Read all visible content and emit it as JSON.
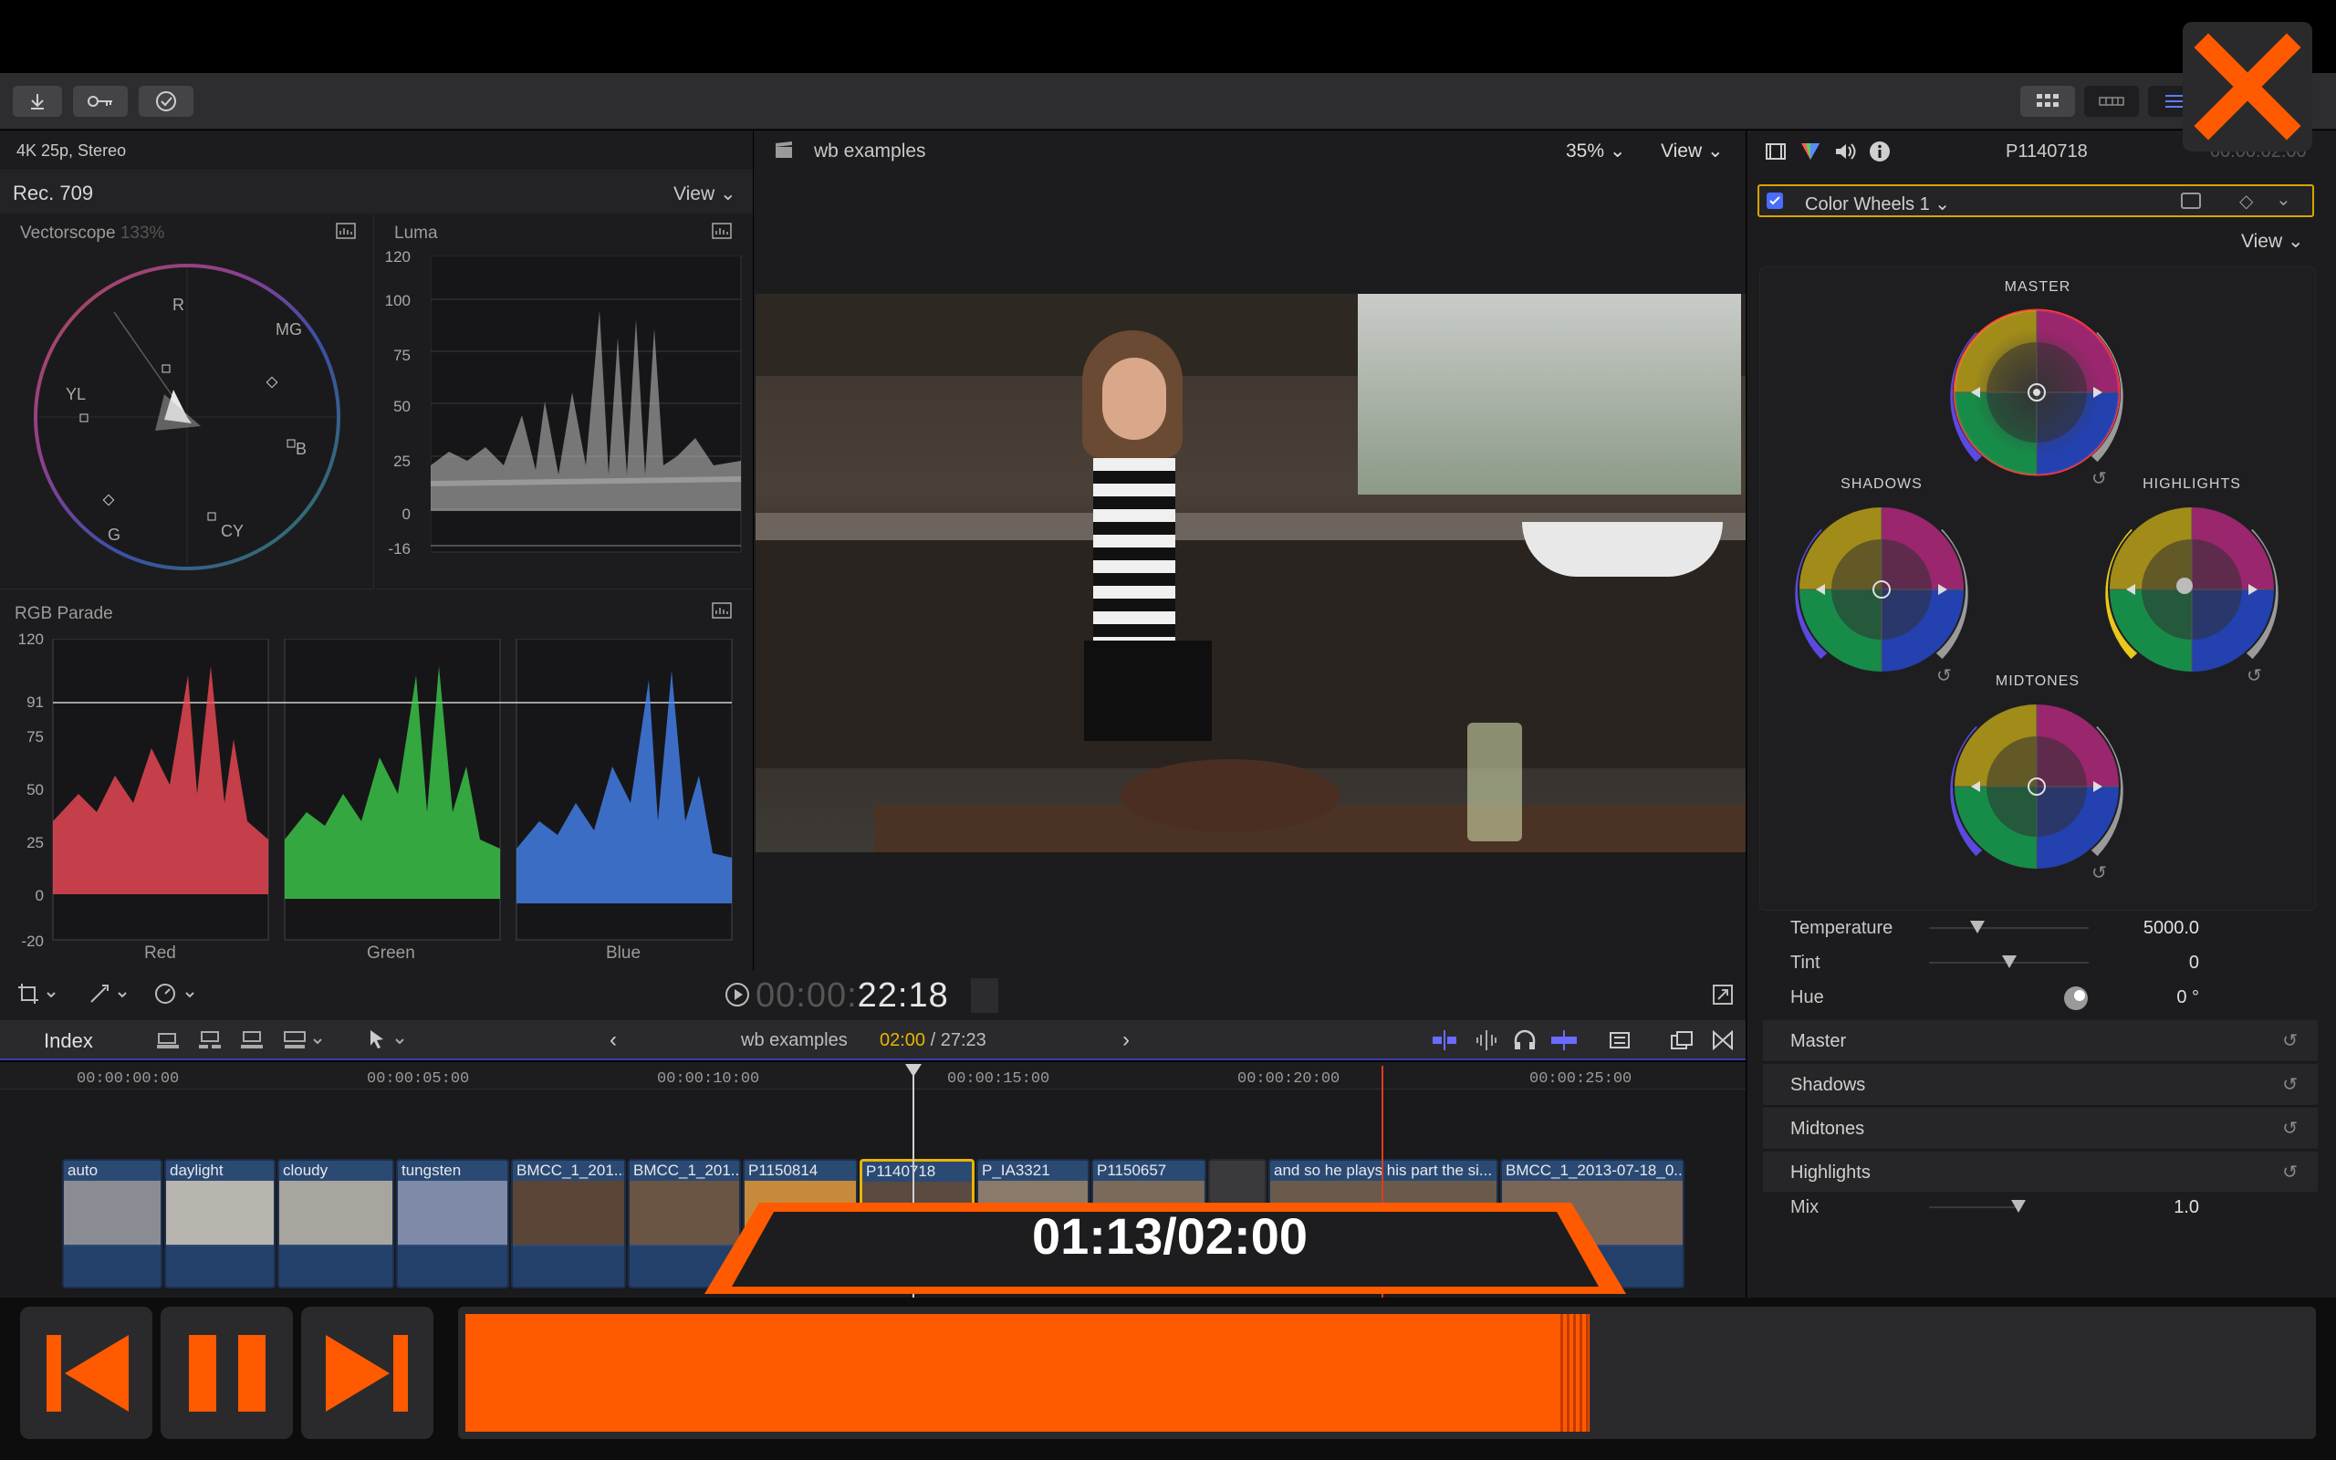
{
  "toolbar": {
    "import_icon": "download-icon",
    "keyword_icon": "key-icon",
    "check_icon": "checkmark-circle-icon"
  },
  "viewer": {
    "format": "4K 25p, Stereo",
    "project_name": "wb examples",
    "zoom": "35%",
    "view_label": "View",
    "timecode_dim": "00:00:",
    "timecode_bright": "22:18"
  },
  "scopes": {
    "colorspace": "Rec. 709",
    "view_label": "View",
    "vectorscope_title": "Vectorscope",
    "vectorscope_zoom": "133%",
    "vector_targets": [
      "R",
      "MG",
      "YL",
      "B",
      "G",
      "CY"
    ],
    "luma_title": "Luma",
    "luma_ticks": [
      "120",
      "100",
      "75",
      "50",
      "25",
      "0",
      "-16"
    ],
    "parade_title": "RGB Parade",
    "parade_ticks": [
      "120",
      "91",
      "75",
      "50",
      "25",
      "0",
      "-20"
    ],
    "parade_channels": [
      "Red",
      "Green",
      "Blue"
    ]
  },
  "inspector": {
    "clip_name": "P1140718",
    "timecode": "00:00:02:00",
    "effect_name": "Color Wheels 1",
    "view_label": "View",
    "wheels": {
      "master": "MASTER",
      "shadows": "SHADOWS",
      "highlights": "HIGHLIGHTS",
      "midtones": "MIDTONES"
    },
    "sliders": [
      {
        "label": "Temperature",
        "value": "5000.0",
        "pos": 0.3
      },
      {
        "label": "Tint",
        "value": "0",
        "pos": 0.5
      },
      {
        "label": "Hue",
        "value": "0 °",
        "pos": 0.9
      }
    ],
    "sections": [
      "Master",
      "Shadows",
      "Midtones",
      "Highlights"
    ],
    "mix": {
      "label": "Mix",
      "value": "1.0",
      "pos": 0.98
    }
  },
  "timeline": {
    "index_label": "Index",
    "project_name": "wb examples",
    "position": "02:00",
    "duration": "/ 27:23",
    "ruler": [
      "00:00:00:00",
      "00:00:05:00",
      "00:00:10:00",
      "00:00:15:00",
      "00:00:20:00",
      "00:00:25:00"
    ],
    "clips": [
      {
        "name": "auto"
      },
      {
        "name": "daylight"
      },
      {
        "name": "cloudy"
      },
      {
        "name": "tungsten"
      },
      {
        "name": "BMCC_1_201..."
      },
      {
        "name": "BMCC_1_201..."
      },
      {
        "name": "P1150814"
      },
      {
        "name": "P1140718"
      },
      {
        "name": "P_IA3321"
      },
      {
        "name": "P1150657"
      },
      {
        "name": ""
      },
      {
        "name": "and so he plays his part the si..."
      },
      {
        "name": "BMCC_1_2013-07-18_0..."
      }
    ]
  },
  "player": {
    "time_display": "01:13/02:00",
    "progress": 0.61,
    "accent": "#ff5a00"
  }
}
